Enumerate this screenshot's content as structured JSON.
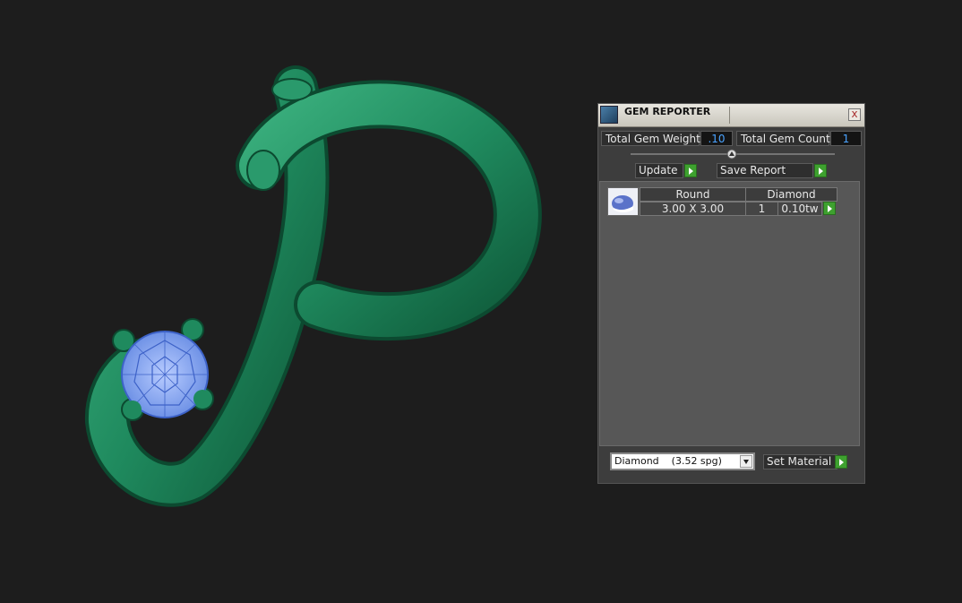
{
  "scene": {
    "object": "letter-p-pendant",
    "colors": {
      "metal": "#1f8a5e",
      "metal_dark": "#0f5a3a",
      "gem": "#8fb0f2",
      "background": "#1d1d1d"
    }
  },
  "panel": {
    "title": "GEM REPORTER",
    "close": "x",
    "total_gem_weight_label": "Total Gem Weight",
    "total_gem_weight_value": ".10",
    "total_gem_count_label": "Total Gem Count",
    "total_gem_count_value": "1",
    "update_label": "Update",
    "save_report_label": "Save Report",
    "gems": [
      {
        "icon": "gem-thumbnail-icon",
        "shape": "Round",
        "material": "Diamond",
        "size": "3.00 X 3.00",
        "count": "1",
        "weight": "0.10tw"
      }
    ],
    "material_select": "Diamond    (3.52 spg)",
    "set_material_label": "Set Material"
  }
}
